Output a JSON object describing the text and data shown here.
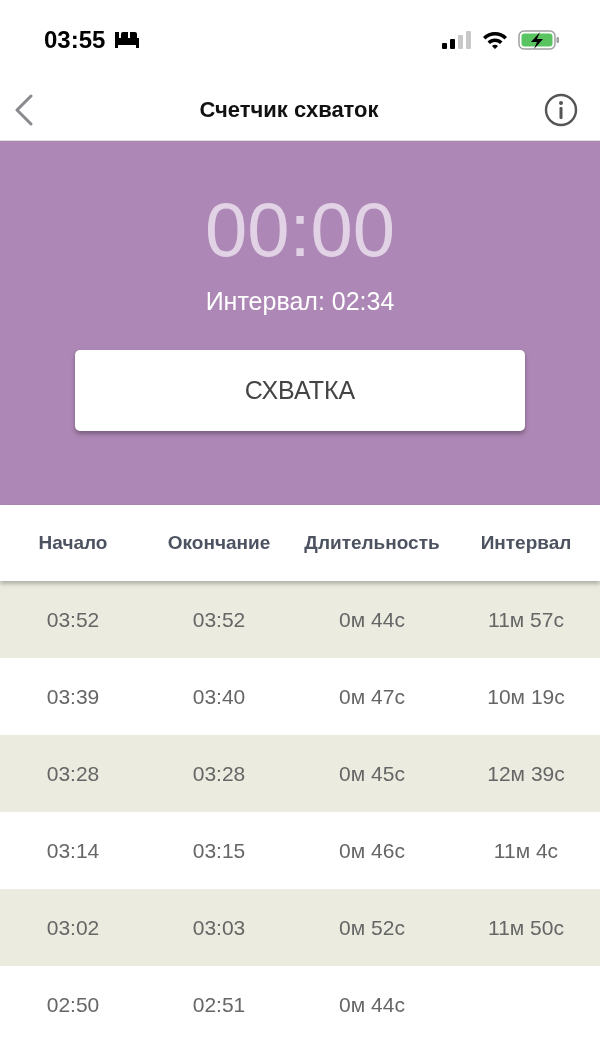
{
  "status_bar": {
    "time": "03:55"
  },
  "nav": {
    "title": "Счетчик схваток"
  },
  "timer": {
    "display": "00:00",
    "interval": "Интервал: 02:34",
    "button": "СХВАТКА"
  },
  "table": {
    "columns": [
      "Начало",
      "Окончание",
      "Длительность",
      "Интервал"
    ],
    "rows": [
      {
        "start": "03:52",
        "end": "03:52",
        "duration": "0м 44с",
        "interval": "11м 57с"
      },
      {
        "start": "03:39",
        "end": "03:40",
        "duration": "0м 47с",
        "interval": "10м 19с"
      },
      {
        "start": "03:28",
        "end": "03:28",
        "duration": "0м 45с",
        "interval": "12м 39с"
      },
      {
        "start": "03:14",
        "end": "03:15",
        "duration": "0м 46с",
        "interval": "11м 4с"
      },
      {
        "start": "03:02",
        "end": "03:03",
        "duration": "0м 52с",
        "interval": "11м 50с"
      },
      {
        "start": "02:50",
        "end": "02:51",
        "duration": "0м 44с"
      }
    ]
  }
}
